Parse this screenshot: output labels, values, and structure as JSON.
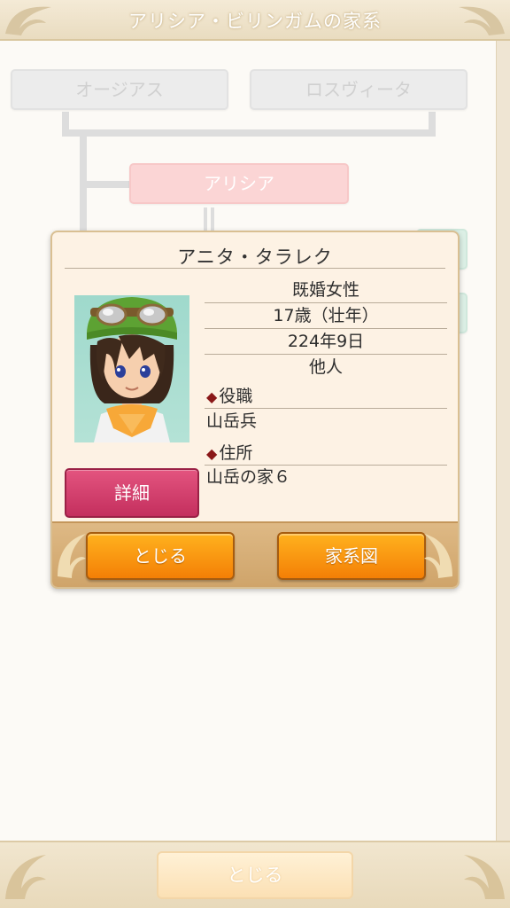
{
  "header": {
    "title": "アリシア・ビリンガムの家系"
  },
  "tree": {
    "nodes": [
      {
        "label": "オージアス"
      },
      {
        "label": "ロスヴィータ"
      },
      {
        "label": "アリシア"
      }
    ]
  },
  "modal": {
    "name": "アニタ・タラレク",
    "info": [
      "既婚女性",
      "17歳（壮年）",
      "224年9日",
      "他人"
    ],
    "role_heading": "役職",
    "role_value": "山岳兵",
    "address_heading": "住所",
    "address_value": "山岳の家６",
    "detail_label": "詳細",
    "close_label": "とじる",
    "family_tree_label": "家系図"
  },
  "footer": {
    "close_label": "とじる"
  },
  "colors": {
    "accent_orange": "#f47f06",
    "detail_pink": "#c42f5e",
    "diamond": "#8a1818"
  }
}
